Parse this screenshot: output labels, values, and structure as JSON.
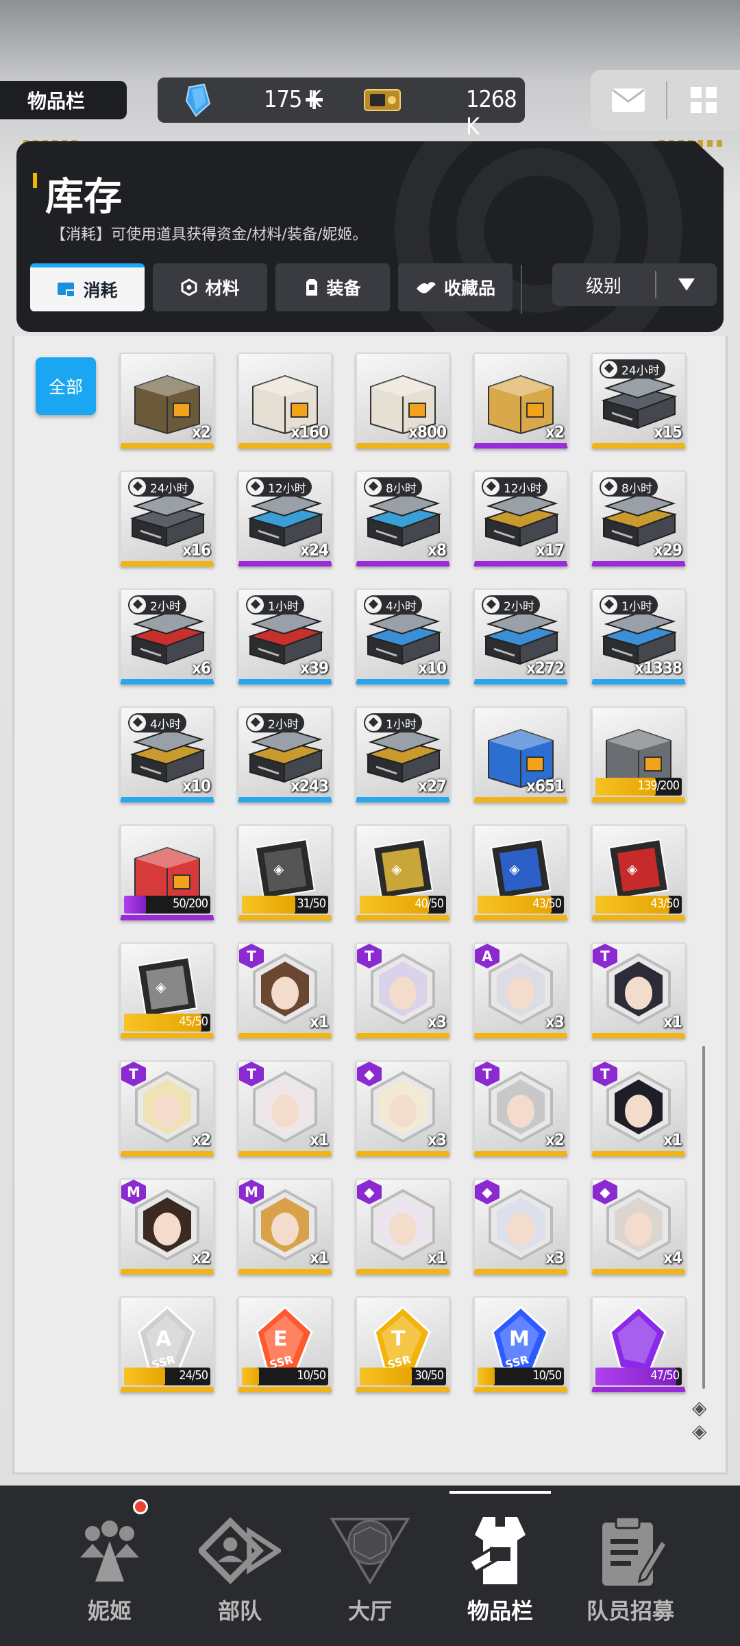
{
  "header": {
    "title": "物品栏",
    "gems": "175 K",
    "gems_plus": "+",
    "credits": "1268 K"
  },
  "panel": {
    "title": "库存",
    "description": "【消耗】可使用道具获得资金/材料/装备/妮姬。",
    "tabs": [
      {
        "label": "消耗",
        "icon": "consumable-icon",
        "active": true
      },
      {
        "label": "材料",
        "icon": "material-icon",
        "active": false
      },
      {
        "label": "装备",
        "icon": "equipment-icon",
        "active": false
      },
      {
        "label": "收藏品",
        "icon": "collectible-icon",
        "active": false
      }
    ],
    "sort_label": "级别"
  },
  "filter_all": "全部",
  "items": [
    {
      "type": "box",
      "color": "#6b5a3a",
      "count": "x2",
      "rarity": "gold"
    },
    {
      "type": "box",
      "color": "#e6e0d4",
      "count": "x160",
      "rarity": "gold"
    },
    {
      "type": "box",
      "color": "#e6e0d4",
      "count": "x800",
      "rarity": "gold"
    },
    {
      "type": "box",
      "color": "#d9a84a",
      "count": "x2",
      "rarity": "purple"
    },
    {
      "type": "case",
      "timer": "24小时",
      "color": "#5b6068",
      "count": "x15",
      "rarity": "gold"
    },
    {
      "type": "case",
      "timer": "24小时",
      "color": "#5b6068",
      "count": "x16",
      "rarity": "gold"
    },
    {
      "type": "case",
      "timer": "12小时",
      "color": "#3a9fd6",
      "count": "x24",
      "rarity": "purple"
    },
    {
      "type": "case",
      "timer": "8小时",
      "color": "#3a9fd6",
      "count": "x8",
      "rarity": "purple"
    },
    {
      "type": "case",
      "timer": "12小时",
      "color": "#c99a2e",
      "count": "x17",
      "rarity": "purple"
    },
    {
      "type": "case",
      "timer": "8小时",
      "color": "#c99a2e",
      "count": "x29",
      "rarity": "purple"
    },
    {
      "type": "case",
      "timer": "2小时",
      "color": "#c9302c",
      "count": "x6",
      "rarity": "blue"
    },
    {
      "type": "case",
      "timer": "1小时",
      "color": "#c9302c",
      "count": "x39",
      "rarity": "blue"
    },
    {
      "type": "case",
      "timer": "4小时",
      "color": "#3a8fd6",
      "count": "x10",
      "rarity": "blue"
    },
    {
      "type": "case",
      "timer": "2小时",
      "color": "#3a8fd6",
      "count": "x272",
      "rarity": "blue"
    },
    {
      "type": "case",
      "timer": "1小时",
      "color": "#3a8fd6",
      "count": "x1338",
      "rarity": "blue"
    },
    {
      "type": "case",
      "timer": "4小时",
      "color": "#c99a2e",
      "count": "x10",
      "rarity": "blue"
    },
    {
      "type": "case",
      "timer": "2小时",
      "color": "#c99a2e",
      "count": "x243",
      "rarity": "blue"
    },
    {
      "type": "case",
      "timer": "1小时",
      "color": "#c99a2e",
      "count": "x27",
      "rarity": "blue"
    },
    {
      "type": "box",
      "color": "#2d6fd1",
      "count": "x651",
      "rarity": "gold"
    },
    {
      "type": "box",
      "color": "#6a6d72",
      "progress": "139/200",
      "fill": 0.695,
      "rarity": "gold"
    },
    {
      "type": "box",
      "color": "#d63a3a",
      "progress": "50/200",
      "fill": 0.25,
      "rarity": "purple",
      "bar": "purple"
    },
    {
      "type": "card",
      "color": "#555555",
      "progress": "31/50",
      "fill": 0.62,
      "rarity": "gold"
    },
    {
      "type": "card",
      "color": "#c9a53a",
      "progress": "40/50",
      "fill": 0.8,
      "rarity": "gold"
    },
    {
      "type": "card",
      "color": "#2c5fc7",
      "progress": "43/50",
      "fill": 0.86,
      "rarity": "gold"
    },
    {
      "type": "card",
      "color": "#c62a2a",
      "progress": "43/50",
      "fill": 0.86,
      "rarity": "gold"
    },
    {
      "type": "card",
      "color": "#888888",
      "progress": "45/50",
      "fill": 0.9,
      "rarity": "gold"
    },
    {
      "type": "portrait",
      "badge": "T",
      "hair": "#6b4630",
      "count": "x1",
      "rarity": "gold"
    },
    {
      "type": "portrait",
      "badge": "T",
      "hair": "#d9d2e8",
      "count": "x3",
      "rarity": "gold"
    },
    {
      "type": "portrait",
      "badge": "A",
      "hair": "#dcdce4",
      "count": "x3",
      "rarity": "gold"
    },
    {
      "type": "portrait",
      "badge": "T",
      "hair": "#2c2c38",
      "count": "x1",
      "rarity": "gold"
    },
    {
      "type": "portrait",
      "badge": "T",
      "hair": "#efe2b4",
      "count": "x2",
      "rarity": "gold"
    },
    {
      "type": "portrait",
      "badge": "T",
      "hair": "#f0e6ea",
      "count": "x1",
      "rarity": "gold"
    },
    {
      "type": "portrait",
      "badge": "◆",
      "hair": "#f2ead2",
      "count": "x3",
      "rarity": "gold"
    },
    {
      "type": "portrait",
      "badge": "T",
      "hair": "#c8c8c8",
      "count": "x2",
      "rarity": "gold"
    },
    {
      "type": "portrait",
      "badge": "T",
      "hair": "#1e1e28",
      "count": "x1",
      "rarity": "gold"
    },
    {
      "type": "portrait",
      "badge": "M",
      "hair": "#3a2a22",
      "count": "x2",
      "rarity": "gold"
    },
    {
      "type": "portrait",
      "badge": "M",
      "hair": "#d9a24a",
      "count": "x1",
      "rarity": "gold"
    },
    {
      "type": "portrait",
      "badge": "◆",
      "hair": "#ece4ee",
      "count": "x1",
      "rarity": "gold"
    },
    {
      "type": "portrait",
      "badge": "◆",
      "hair": "#dde0ea",
      "count": "x3",
      "rarity": "gold"
    },
    {
      "type": "portrait",
      "badge": "◆",
      "hair": "#ddd6d0",
      "count": "x4",
      "rarity": "gold"
    },
    {
      "type": "crystal",
      "color": "#cfcfcf",
      "letter": "A",
      "progress": "24/50",
      "fill": 0.48,
      "rarity": "gold"
    },
    {
      "type": "crystal",
      "color": "#ff5a2e",
      "letter": "E",
      "progress": "10/50",
      "fill": 0.2,
      "rarity": "gold"
    },
    {
      "type": "crystal",
      "color": "#f2b40c",
      "letter": "T",
      "progress": "30/50",
      "fill": 0.6,
      "rarity": "gold"
    },
    {
      "type": "crystal",
      "color": "#2e5bff",
      "letter": "M",
      "progress": "10/50",
      "fill": 0.2,
      "rarity": "gold"
    },
    {
      "type": "crystal",
      "color": "#8a2ae8",
      "letter": "",
      "progress": "47/50",
      "fill": 0.94,
      "rarity": "purple",
      "bar": "purple"
    }
  ],
  "nav": [
    {
      "label": "妮姬",
      "icon": "nikke-icon",
      "active": false
    },
    {
      "label": "部队",
      "icon": "squad-icon",
      "active": false
    },
    {
      "label": "大厅",
      "icon": "lobby-icon",
      "active": false
    },
    {
      "label": "物品栏",
      "icon": "inventory-icon",
      "active": true
    },
    {
      "label": "队员招募",
      "icon": "recruit-icon",
      "active": false
    }
  ]
}
